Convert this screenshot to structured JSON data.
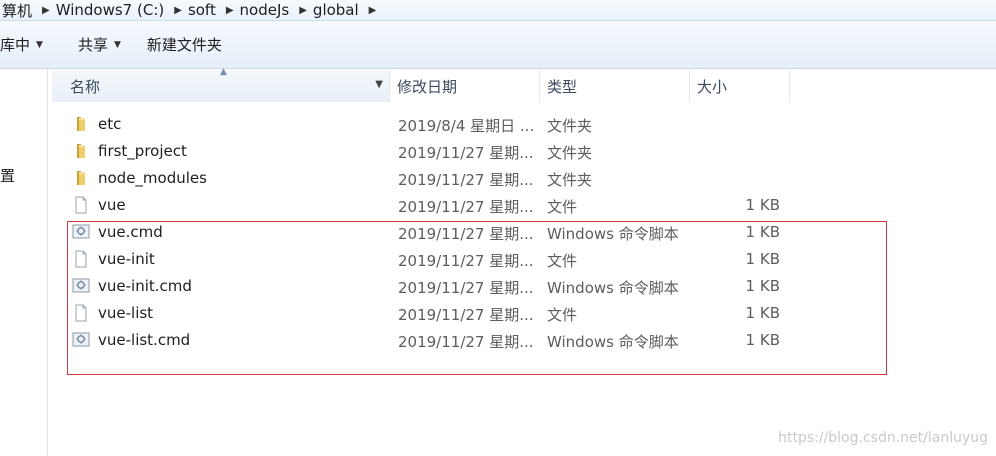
{
  "breadcrumb": {
    "items": [
      "算机",
      "Windows7 (C:)",
      "soft",
      "nodeJs",
      "global"
    ]
  },
  "toolbar": {
    "library_label": "库中",
    "share_label": "共享",
    "new_folder_label": "新建文件夹"
  },
  "navpane": {
    "item_label": "置"
  },
  "columns": {
    "name": "名称",
    "date": "修改日期",
    "type": "类型",
    "size": "大小"
  },
  "files": [
    {
      "name": "etc",
      "date": "2019/8/4 星期日 ...",
      "type": "文件夹",
      "size": "",
      "icon": "folder-icon"
    },
    {
      "name": "first_project",
      "date": "2019/11/27 星期...",
      "type": "文件夹",
      "size": "",
      "icon": "folder-icon"
    },
    {
      "name": "node_modules",
      "date": "2019/11/27 星期...",
      "type": "文件夹",
      "size": "",
      "icon": "folder-icon"
    },
    {
      "name": "vue",
      "date": "2019/11/27 星期...",
      "type": "文件",
      "size": "1 KB",
      "icon": "file-icon"
    },
    {
      "name": "vue.cmd",
      "date": "2019/11/27 星期...",
      "type": "Windows 命令脚本",
      "size": "1 KB",
      "icon": "cmd-script-icon"
    },
    {
      "name": "vue-init",
      "date": "2019/11/27 星期...",
      "type": "文件",
      "size": "1 KB",
      "icon": "file-icon"
    },
    {
      "name": "vue-init.cmd",
      "date": "2019/11/27 星期...",
      "type": "Windows 命令脚本",
      "size": "1 KB",
      "icon": "cmd-script-icon"
    },
    {
      "name": "vue-list",
      "date": "2019/11/27 星期...",
      "type": "文件",
      "size": "1 KB",
      "icon": "file-icon"
    },
    {
      "name": "vue-list.cmd",
      "date": "2019/11/27 星期...",
      "type": "Windows 命令脚本",
      "size": "1 KB",
      "icon": "cmd-script-icon"
    }
  ],
  "watermark": "https://blog.csdn.net/lanluyug",
  "colors": {
    "highlight_border": "#d7383f",
    "folder": "#e8c35a"
  }
}
